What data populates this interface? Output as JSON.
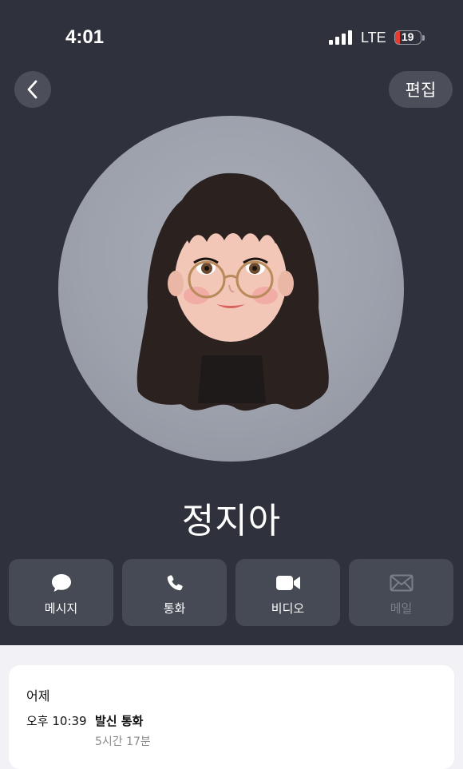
{
  "status_bar": {
    "time": "4:01",
    "network": "LTE",
    "battery": "19",
    "battery_level": 0.19
  },
  "nav": {
    "back_icon": "chevron-left-icon",
    "edit_label": "편집"
  },
  "contact": {
    "name": "정지아",
    "avatar": "memoji-avatar"
  },
  "actions": [
    {
      "label": "메시지",
      "icon": "message-bubble-icon",
      "enabled": true
    },
    {
      "label": "통화",
      "icon": "phone-icon",
      "enabled": true
    },
    {
      "label": "비디오",
      "icon": "video-camera-icon",
      "enabled": true
    },
    {
      "label": "메일",
      "icon": "envelope-icon",
      "enabled": false
    }
  ],
  "recent_calls": {
    "day": "어제",
    "items": [
      {
        "time": "오후 10:39",
        "type": "발신 통화",
        "duration": "5시간 17분"
      }
    ]
  },
  "colors": {
    "header_bg": "#2f323c",
    "button_bg": "#464a54",
    "battery_low": "#e53c2f",
    "page_bg": "#f2f2f6"
  }
}
